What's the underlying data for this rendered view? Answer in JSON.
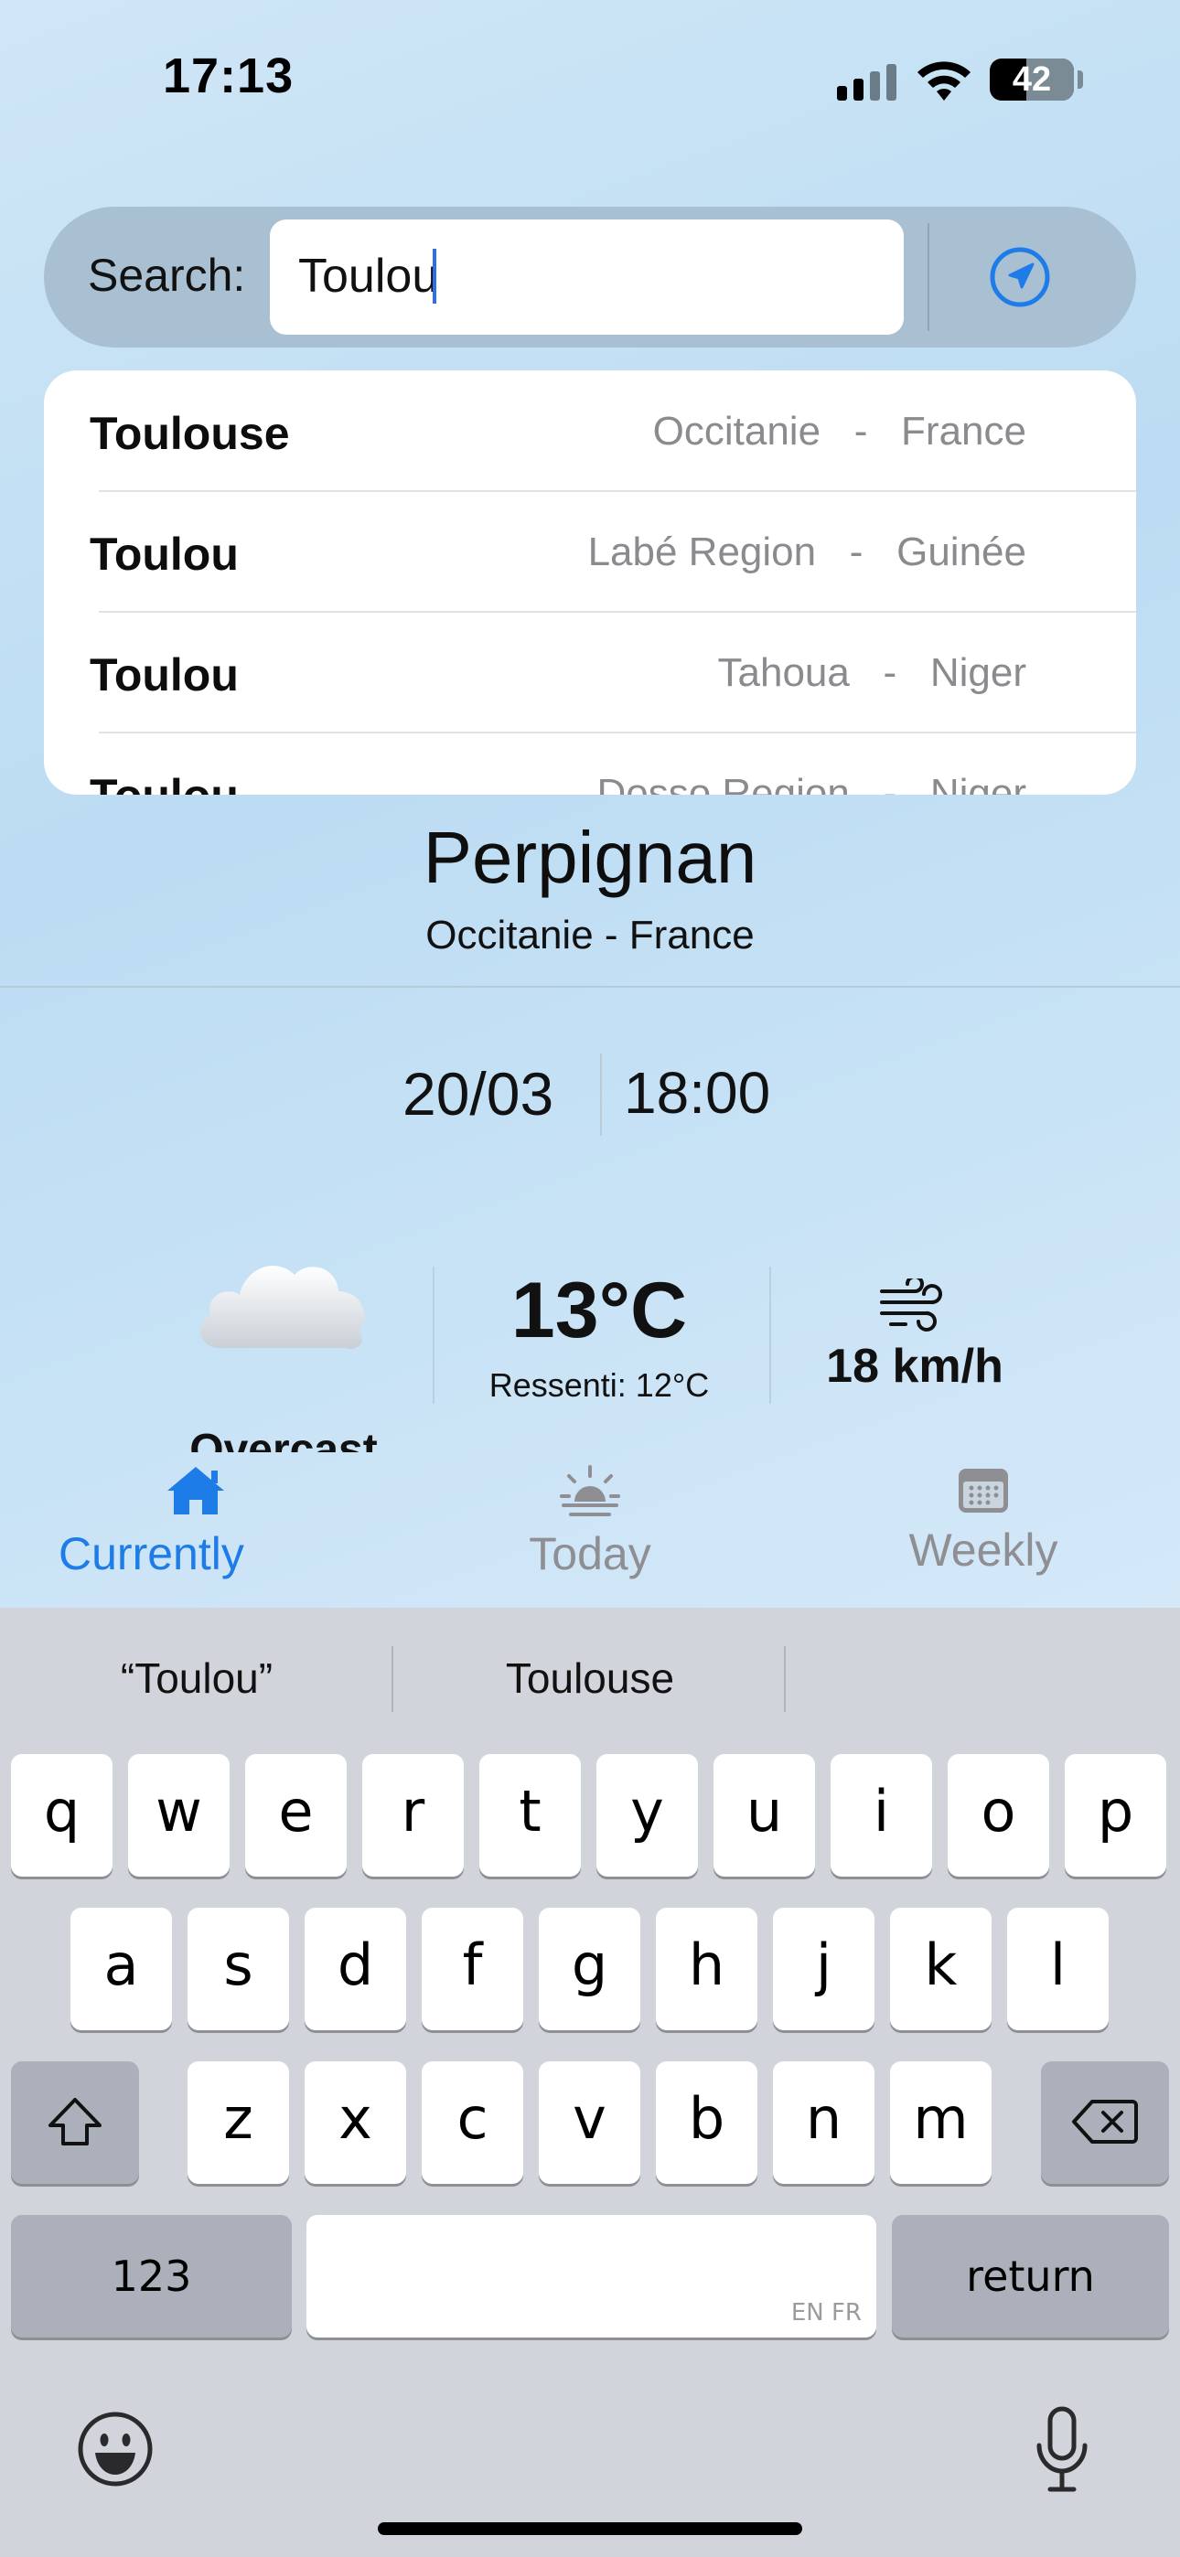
{
  "status_bar": {
    "time": "17:13",
    "battery": "42"
  },
  "search": {
    "label": "Search:",
    "value": "Toulou"
  },
  "suggestions": [
    {
      "city": "Toulouse",
      "region": "Occitanie   -   France"
    },
    {
      "city": "Toulou",
      "region": "Labé Region   -   Guinée"
    },
    {
      "city": "Toulou",
      "region": "Tahoua   -   Niger"
    },
    {
      "city": "Toulou",
      "region": "Dosso Region   -   Niger"
    }
  ],
  "location": {
    "city": "Perpignan",
    "region": "Occitanie - France"
  },
  "datetime": {
    "date": "20/03",
    "time": "18:00"
  },
  "weather": {
    "condition": "Overcast",
    "temperature": "13°C",
    "feels_like": "Ressenti: 12°C",
    "wind": "18 km/h"
  },
  "tabs": [
    {
      "label": "Currently",
      "icon": "house-icon",
      "active": true
    },
    {
      "label": "Today",
      "icon": "sunrise-icon",
      "active": false
    },
    {
      "label": "Weekly",
      "icon": "calendar-icon",
      "active": false
    }
  ],
  "keyboard": {
    "predictions": [
      "“Toulou”",
      "Toulouse",
      ""
    ],
    "row1": [
      "q",
      "w",
      "e",
      "r",
      "t",
      "y",
      "u",
      "i",
      "o",
      "p"
    ],
    "row2": [
      "a",
      "s",
      "d",
      "f",
      "g",
      "h",
      "j",
      "k",
      "l"
    ],
    "row3": [
      "z",
      "x",
      "c",
      "v",
      "b",
      "n",
      "m"
    ],
    "numbers_key": "123",
    "return_key": "return",
    "space_lang": "EN FR"
  },
  "colors": {
    "accent": "#1e7ce8",
    "inactive": "#8e8e93"
  }
}
